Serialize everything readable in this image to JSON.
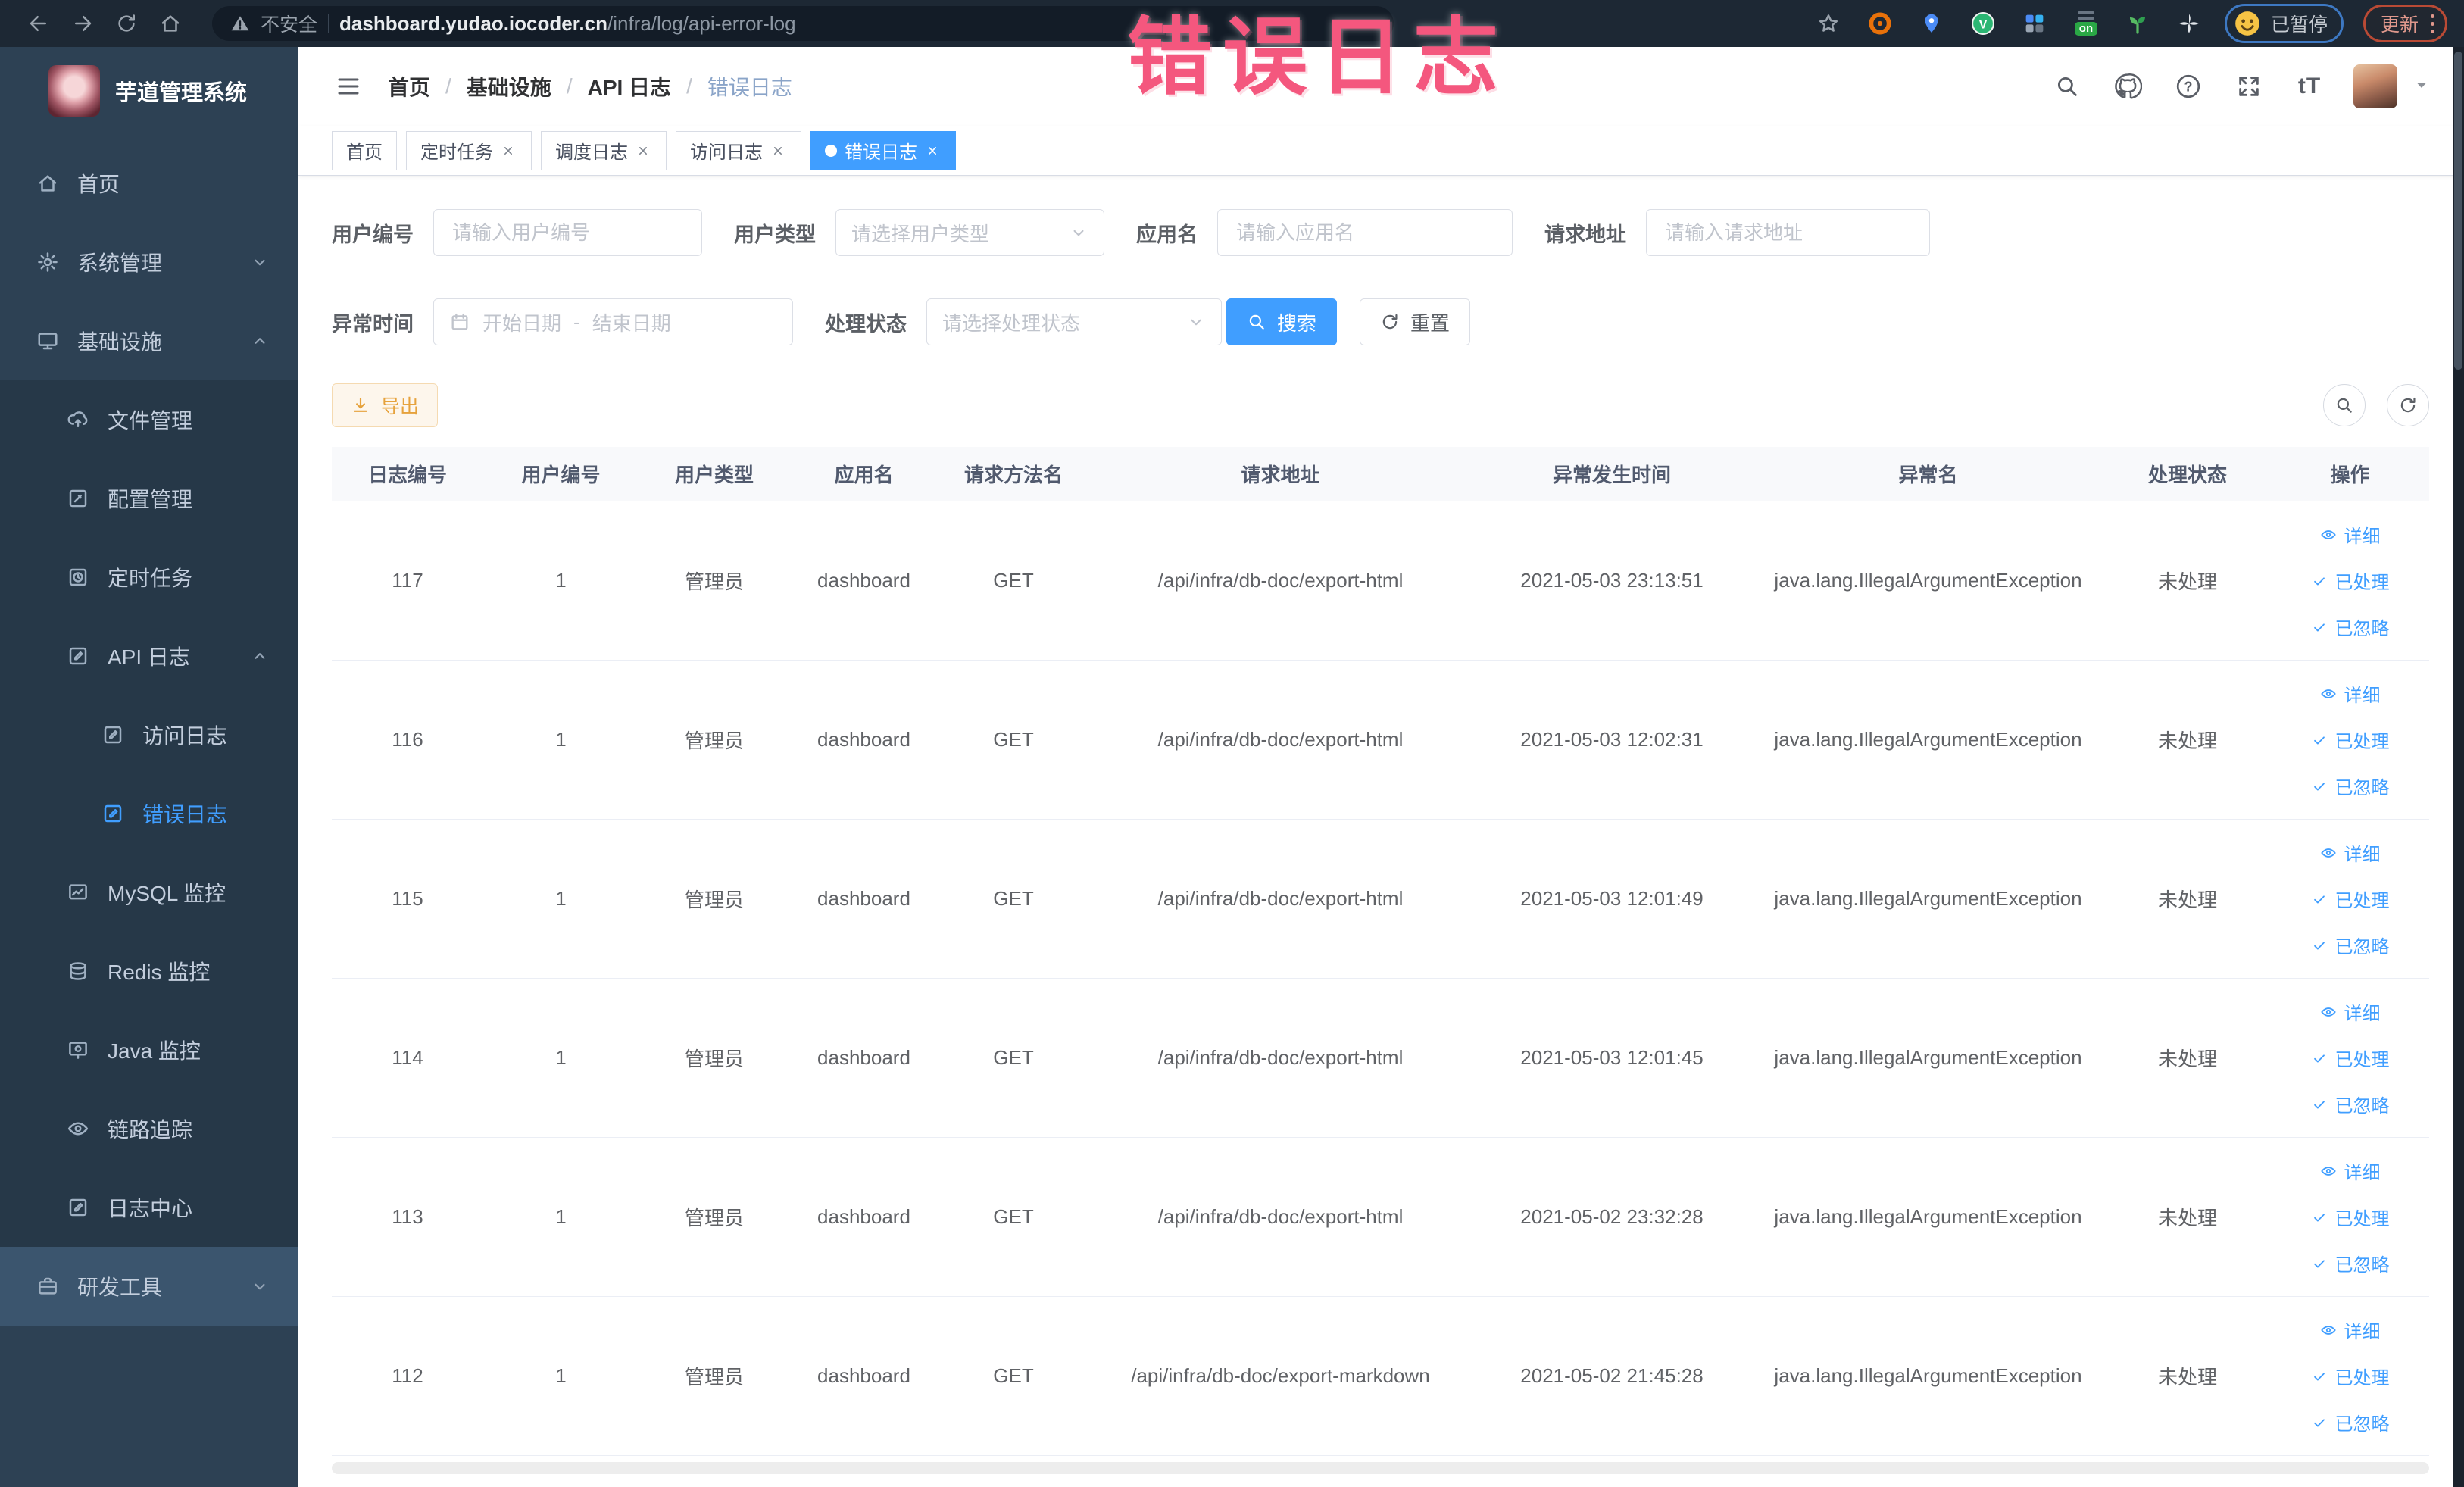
{
  "browser": {
    "security_label": "不安全",
    "url_host": "dashboard.yudao.iocoder.cn",
    "url_path": "/infra/log/api-error-log",
    "extension_v_label": "V",
    "extension_switch_label": "on",
    "paused_badge_label": "已暂停",
    "update_button_label": "更新"
  },
  "watermark_text": "错误日志",
  "sidebar": {
    "title": "芋道管理系统",
    "items": [
      {
        "id": "home",
        "label": "首页",
        "icon": "home-icon",
        "level": 1
      },
      {
        "id": "system",
        "label": "系统管理",
        "icon": "gear-icon",
        "level": 1,
        "chevron": "down"
      },
      {
        "id": "infra",
        "label": "基础设施",
        "icon": "monitor-icon",
        "level": 1,
        "chevron": "up"
      },
      {
        "id": "file",
        "label": "文件管理",
        "icon": "upload-icon",
        "level": 2,
        "section": true
      },
      {
        "id": "config",
        "label": "配置管理",
        "icon": "edit-icon",
        "level": 2,
        "section": true
      },
      {
        "id": "job",
        "label": "定时任务",
        "icon": "job-icon",
        "level": 2,
        "section": true
      },
      {
        "id": "api-log",
        "label": "API 日志",
        "icon": "log-icon",
        "level": 2,
        "section": true,
        "chevron": "up"
      },
      {
        "id": "access-log",
        "label": "访问日志",
        "icon": "log-icon",
        "level": 3,
        "section": true
      },
      {
        "id": "error-log",
        "label": "错误日志",
        "icon": "log-icon",
        "level": 3,
        "section": true,
        "active": true
      },
      {
        "id": "mysql",
        "label": "MySQL 监控",
        "icon": "chart-icon",
        "level": 2,
        "section": true
      },
      {
        "id": "redis",
        "label": "Redis 监控",
        "icon": "database-icon",
        "level": 2,
        "section": true
      },
      {
        "id": "java",
        "label": "Java 监控",
        "icon": "screen-icon",
        "level": 2,
        "section": true
      },
      {
        "id": "trace",
        "label": "链路追踪",
        "icon": "eye-icon",
        "level": 2,
        "section": true
      },
      {
        "id": "log-center",
        "label": "日志中心",
        "icon": "log-icon",
        "level": 2,
        "section": true
      },
      {
        "id": "dev-tool",
        "label": "研发工具",
        "icon": "briefcase-icon",
        "level": 1,
        "chevron": "down",
        "tone": "light"
      }
    ]
  },
  "navbar": {
    "help_icon_text": "?",
    "font_size_icon_text": "tT"
  },
  "breadcrumb": [
    "首页",
    "基础设施",
    "API 日志",
    "错误日志"
  ],
  "tabs": [
    {
      "label": "首页",
      "closable": false,
      "active": false
    },
    {
      "label": "定时任务",
      "closable": true,
      "active": false
    },
    {
      "label": "调度日志",
      "closable": true,
      "active": false
    },
    {
      "label": "访问日志",
      "closable": true,
      "active": false
    },
    {
      "label": "错误日志",
      "closable": true,
      "active": true
    }
  ],
  "filters": {
    "user_id": {
      "label": "用户编号",
      "placeholder": "请输入用户编号"
    },
    "user_type": {
      "label": "用户类型",
      "placeholder": "请选择用户类型"
    },
    "app_name": {
      "label": "应用名",
      "placeholder": "请输入应用名"
    },
    "request_url": {
      "label": "请求地址",
      "placeholder": "请输入请求地址"
    },
    "exception_time": {
      "label": "异常时间",
      "start_placeholder": "开始日期",
      "separator": "-",
      "end_placeholder": "结束日期"
    },
    "process_status": {
      "label": "处理状态",
      "placeholder": "请选择处理状态"
    },
    "search_button": "搜索",
    "reset_button": "重置"
  },
  "toolbar": {
    "export_button": "导出"
  },
  "table": {
    "columns": [
      "日志编号",
      "用户编号",
      "用户类型",
      "应用名",
      "请求方法名",
      "请求地址",
      "异常发生时间",
      "异常名",
      "处理状态",
      "操作"
    ],
    "rows": [
      [
        "117",
        "1",
        "管理员",
        "dashboard",
        "GET",
        "/api/infra/db-doc/export-html",
        "2021-05-03 23:13:51",
        "java.lang.IllegalArgumentException",
        "未处理"
      ],
      [
        "116",
        "1",
        "管理员",
        "dashboard",
        "GET",
        "/api/infra/db-doc/export-html",
        "2021-05-03 12:02:31",
        "java.lang.IllegalArgumentException",
        "未处理"
      ],
      [
        "115",
        "1",
        "管理员",
        "dashboard",
        "GET",
        "/api/infra/db-doc/export-html",
        "2021-05-03 12:01:49",
        "java.lang.IllegalArgumentException",
        "未处理"
      ],
      [
        "114",
        "1",
        "管理员",
        "dashboard",
        "GET",
        "/api/infra/db-doc/export-html",
        "2021-05-03 12:01:45",
        "java.lang.IllegalArgumentException",
        "未处理"
      ],
      [
        "113",
        "1",
        "管理员",
        "dashboard",
        "GET",
        "/api/infra/db-doc/export-html",
        "2021-05-02 23:32:28",
        "java.lang.IllegalArgumentException",
        "未处理"
      ],
      [
        "112",
        "1",
        "管理员",
        "dashboard",
        "GET",
        "/api/infra/db-doc/export-markdown",
        "2021-05-02 21:45:28",
        "java.lang.IllegalArgumentException",
        "未处理"
      ]
    ],
    "actions": {
      "detail": "详细",
      "processed": "已处理",
      "ignored": "已忽略"
    }
  },
  "colors": {
    "primary": "#409eff",
    "warning": "#e6a23c",
    "sidebar_bg": "#2d4154",
    "sidebar_submenu_bg": "#263848",
    "active_tab_bg": "#409eff",
    "watermark": "#f4577e",
    "table_header_bg": "#f8f9fb"
  }
}
